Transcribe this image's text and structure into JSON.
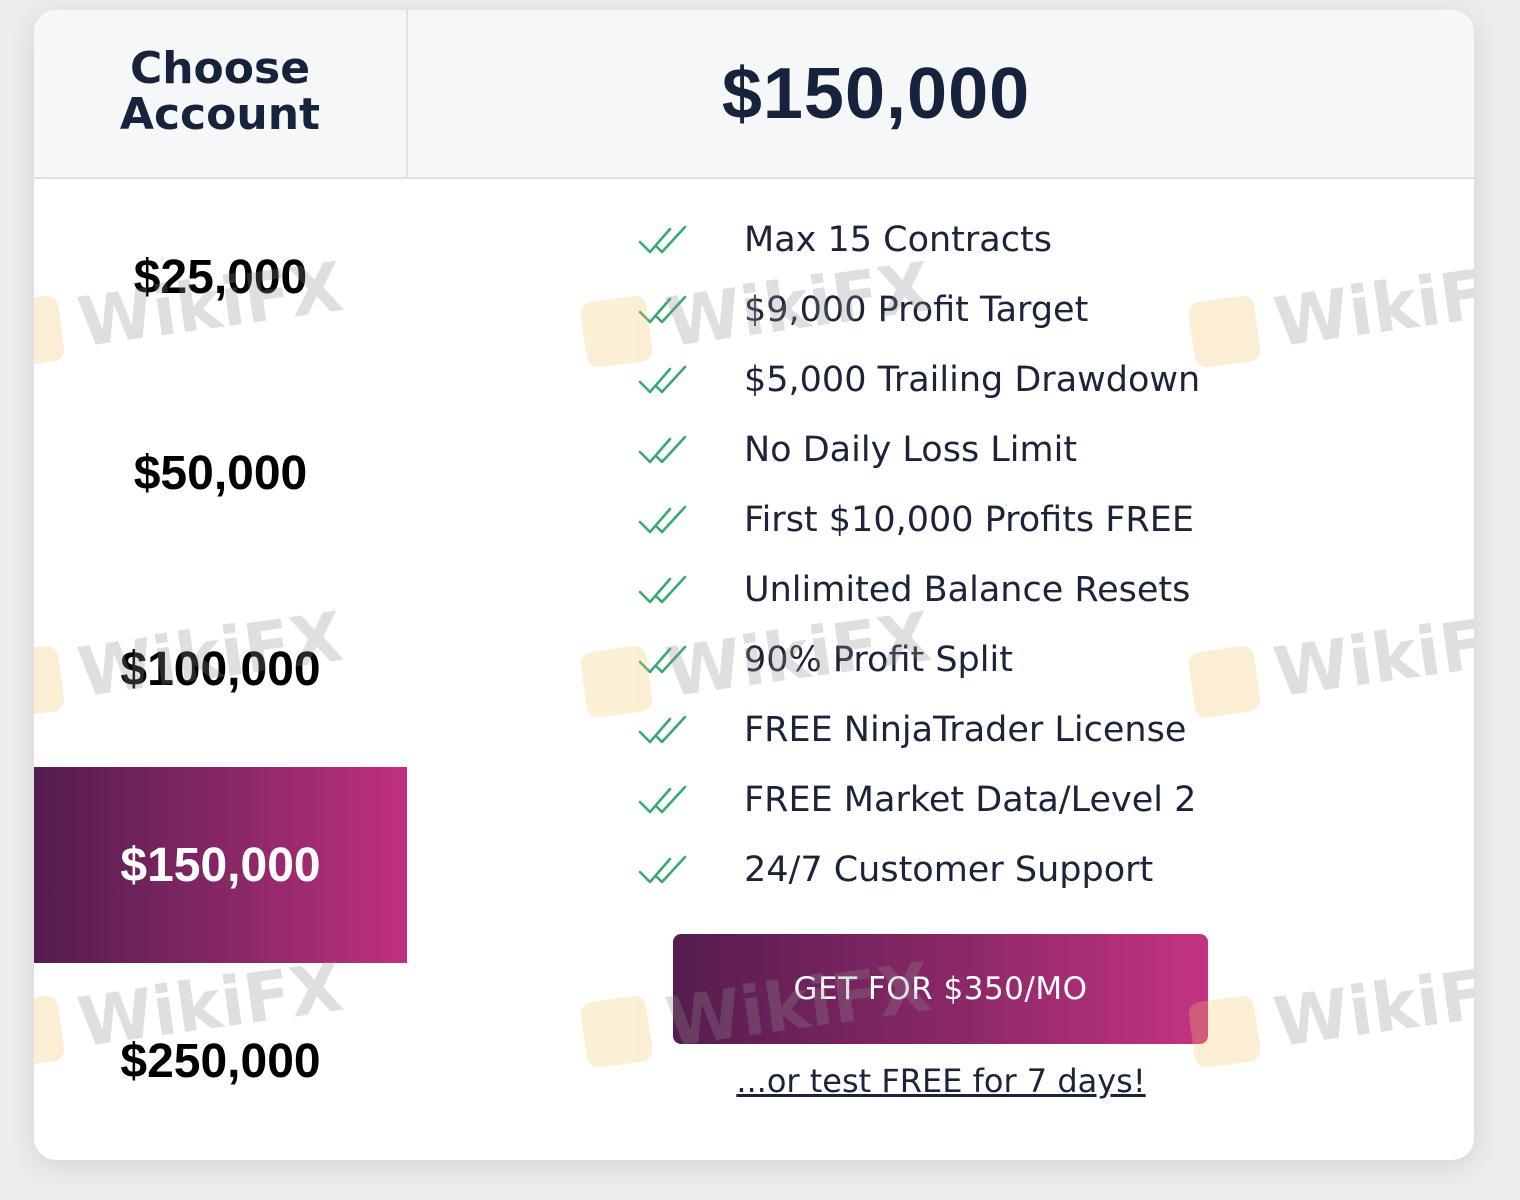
{
  "header": {
    "choose_label": "Choose Account",
    "selected_amount": "$150,000"
  },
  "accounts": [
    {
      "label": "$25,000",
      "selected": false
    },
    {
      "label": "$50,000",
      "selected": false
    },
    {
      "label": "$100,000",
      "selected": false
    },
    {
      "label": "$150,000",
      "selected": true
    },
    {
      "label": "$250,000",
      "selected": false
    }
  ],
  "features": [
    "Max 15 Contracts",
    "$9,000 Profit Target",
    "$5,000 Trailing Drawdown",
    "No Daily Loss Limit",
    "First $10,000 Profits FREE",
    "Unlimited Balance Resets",
    "90% Profit Split",
    "FREE NinjaTrader License",
    "FREE Market Data/Level 2",
    "24/7 Customer Support"
  ],
  "feature_icon": "double-check-icon",
  "cta": {
    "label": "GET FOR $350/MO",
    "trial_link": "...or test FREE for 7 days!"
  },
  "colors": {
    "heading": "#17233d",
    "gradient_start": "#531c4f",
    "gradient_end": "#c0307e",
    "check": "#3aa872"
  },
  "watermark": "WikiFX"
}
